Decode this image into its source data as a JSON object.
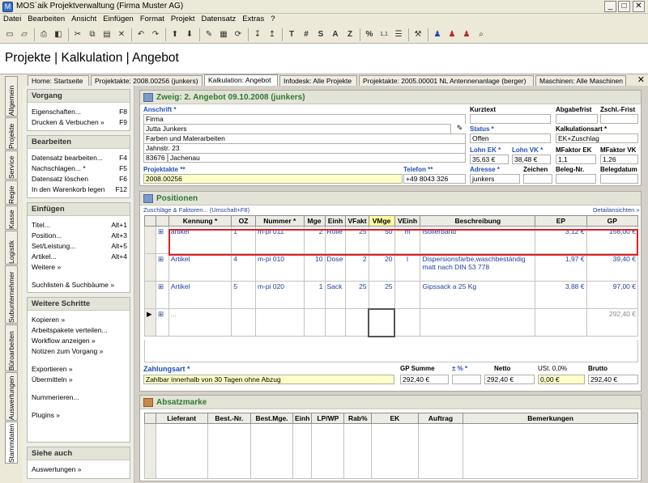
{
  "window": {
    "title": "MOS`aik Projektverwaltung (Firma Muster AG)",
    "min": "_",
    "max": "□",
    "close": "✕"
  },
  "menu": [
    "Datei",
    "Bearbeiten",
    "Ansicht",
    "Einfügen",
    "Format",
    "Projekt",
    "Datensatz",
    "Extras",
    "?"
  ],
  "toolbar": {
    "t_text": "T",
    "t_sharp": "#",
    "t_s": "S",
    "t_a": "A",
    "t_z": "Z",
    "t_pct": "%",
    "t_num": "1,1"
  },
  "page_title": "Projekte | Kalkulation | Angebot",
  "tabs": [
    "Home: Startseite",
    "Projektakte: 2008.00256 (junkers)",
    "Kalkulation: Angebot",
    "Infodesk: Alle Projekte",
    "Projektakte: 2005.00001 NL Antennenanlage (berger)",
    "Maschinen: Alle Maschinen"
  ],
  "tab_close": "✕",
  "vtabs": [
    "Allgemein",
    "Projekte",
    "Service",
    "Regie",
    "Kasse",
    "Logistik",
    "Subunternehmer",
    "Büroarbeiten",
    "Auswertungen",
    "Stammdaten"
  ],
  "sidebar": {
    "vorgang": {
      "title": "Vorgang",
      "items": [
        {
          "label": "Eigenschaften...",
          "key": "F8"
        },
        {
          "label": "Drucken & Verbuchen »",
          "key": "F9"
        }
      ]
    },
    "bearbeiten": {
      "title": "Bearbeiten",
      "items": [
        {
          "label": "Datensatz bearbeiten...",
          "key": "F4"
        },
        {
          "label": "Nachschlagen... *",
          "key": "F5"
        },
        {
          "label": "Datensatz löschen",
          "key": "F6"
        },
        {
          "label": "In den Warenkorb legen",
          "key": "F12"
        }
      ]
    },
    "einfuegen": {
      "title": "Einfügen",
      "items": [
        {
          "label": "Titel...",
          "key": "Alt+1"
        },
        {
          "label": "Position...",
          "key": "Alt+3"
        },
        {
          "label": "Set/Leistung...",
          "key": "Alt+5"
        },
        {
          "label": "Artikel...",
          "key": "Alt+4"
        },
        {
          "label": "Weitere »",
          "key": ""
        },
        {
          "label": "Suchlisten & Suchbäume »",
          "key": ""
        }
      ]
    },
    "weitere": {
      "title": "Weitere Schritte",
      "items": [
        "Kopieren »",
        "Arbeitspakete verteilen...",
        "Workflow anzeigen »",
        "Notizen zum Vorgang »",
        "Exportieren »",
        "Übermitteln »",
        "Nummerieren...",
        "Plugins »"
      ]
    },
    "siehe": {
      "title": "Siehe auch",
      "items": [
        "Auswertungen »"
      ]
    }
  },
  "header_panel": {
    "title": "Zweig: 2. Angebot 09.10.2008 (junkers)",
    "anschrift_label": "Anschrift *",
    "anschrift": [
      "Firma",
      "Jutta Junkers",
      "Farben und Malerarbeiten",
      "Jahnstr. 23"
    ],
    "plz": "83676",
    "ort": "Jachenau",
    "projektakte_label": "Projektakte **",
    "projektakte": "2008.00256",
    "telefon_label": "Telefon **",
    "telefon": "+49 8043 326",
    "kurztext_label": "Kurztext",
    "kurztext": "",
    "status_label": "Status *",
    "status": "Offen",
    "abgabefrist_label": "Abgabefrist",
    "zschl_label": "Zschl.-Frist",
    "kalkart_label": "Kalkulationsart *",
    "kalkart": "EK+Zuschlag",
    "lohn_ek_label": "Lohn EK *",
    "lohn_ek": "35,63 €",
    "lohn_vk_label": "Lohn VK *",
    "lohn_vk": "38,48 €",
    "mfaktor_ek_label": "MFaktor EK",
    "mfaktor_ek": "1,1",
    "mfaktor_vk_label": "MFaktor VK",
    "mfaktor_vk": "1,26",
    "adresse_label": "Adresse *",
    "adresse": "junkers",
    "zeichen_label": "Zeichen",
    "beleg_nr_label": "Beleg-Nr.",
    "belegdatum_label": "Belegdatum"
  },
  "positions": {
    "title": "Positionen",
    "link_left": "Zuschläge & Faktoren... (Umschalt+F8)",
    "link_right": "Detailansichten »",
    "columns": [
      "Kennung *",
      "OZ",
      "Nummer *",
      "Mge",
      "Einh",
      "VFakt",
      "VMge",
      "VEinh",
      "Beschreibung",
      "EP",
      "GP"
    ],
    "rows": [
      {
        "kennung": "artikel",
        "oz": "1",
        "nummer": "m-pi 011",
        "mge": "2",
        "einh": "Rolle",
        "vfakt": "25",
        "vmge": "50",
        "veinh": "m",
        "beschreibung": "Isolierband",
        "ep": "3,12 €",
        "gp": "156,00 €"
      },
      {
        "kennung": "Artikel",
        "oz": "4",
        "nummer": "m-pi 010",
        "mge": "10",
        "einh": "Dose",
        "vfakt": "2",
        "vmge": "20",
        "veinh": "l",
        "beschreibung": "Dispersionsfarbe,waschbeständig matt nach DIN 53 778",
        "ep": "1,97 €",
        "gp": "39,40 €"
      },
      {
        "kennung": "Artikel",
        "oz": "5",
        "nummer": "m-pi 020",
        "mge": "1",
        "einh": "Sack",
        "vfakt": "25",
        "vmge": "25",
        "veinh": "",
        "beschreibung": "Gipssack a 25 Kg",
        "ep": "3,88 €",
        "gp": "97,00 €"
      }
    ],
    "new_row_kennung": "...",
    "total_gp": "292,40 €",
    "zahlungsart_label": "Zahlungsart *",
    "zahlungsart": "Zahlbar innerhalb von 30 Tagen ohne Abzug",
    "gp_summe_label": "GP Summe",
    "gp_summe": "292,40 €",
    "pm_pct_label": "± % *",
    "pm_pct": "",
    "netto_label": "Netto",
    "netto": "292,40 €",
    "ust_label": "USt. 0,0%",
    "ust": "0,00 €",
    "brutto_label": "Brutto",
    "brutto": "292,40 €"
  },
  "absatz": {
    "title": "Absatzmarke",
    "columns": [
      "Lieferant",
      "Best.-Nr.",
      "Best.Mge.",
      "Einh",
      "LP/WP",
      "Rab%",
      "EK",
      "Auftrag",
      "Bemerkungen"
    ]
  }
}
